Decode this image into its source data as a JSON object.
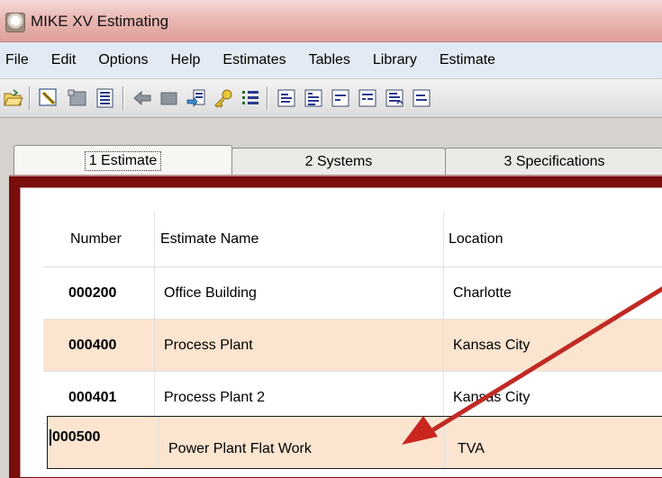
{
  "window": {
    "title": "MIKE XV Estimating",
    "app_icon": "mike-app-icon"
  },
  "menu": {
    "items": [
      "File",
      "Edit",
      "Options",
      "Help",
      "Estimates",
      "Tables",
      "Library",
      "Estimate"
    ]
  },
  "toolbar": {
    "buttons": [
      "open-folder-icon",
      "edit-pencil-icon",
      "card-icon",
      "list-icon",
      "back-arrow-icon",
      "forward-arrow-icon",
      "assign-icon",
      "key-icon",
      "numbered-list-icon",
      "report-a-icon",
      "report-b-icon",
      "report-c-icon",
      "report-d-icon",
      "report-e-icon",
      "report-f-icon"
    ]
  },
  "tabs": [
    {
      "label": "1 Estimate",
      "active": true
    },
    {
      "label": "2 Systems",
      "active": false
    },
    {
      "label": "3 Specifications",
      "active": false
    }
  ],
  "grid": {
    "headers": {
      "number": "Number",
      "name": "Estimate Name",
      "location": "Location"
    },
    "rows": [
      {
        "number": "000200",
        "name": "Office Building",
        "location": "Charlotte"
      },
      {
        "number": "000400",
        "name": "Process Plant",
        "location": "Kansas City"
      },
      {
        "number": "000401",
        "name": "Process Plant 2",
        "location": "Kansas City"
      },
      {
        "number": "000500",
        "name": "Power Plant Flat Work",
        "location": "TVA"
      }
    ]
  },
  "colors": {
    "title_bar": "#e9b8b3",
    "menu_bar": "#e2eaf3",
    "frame": "#7a0d0d",
    "row_alt": "#fbe4d0",
    "annotation_arrow": "#c8261e"
  }
}
